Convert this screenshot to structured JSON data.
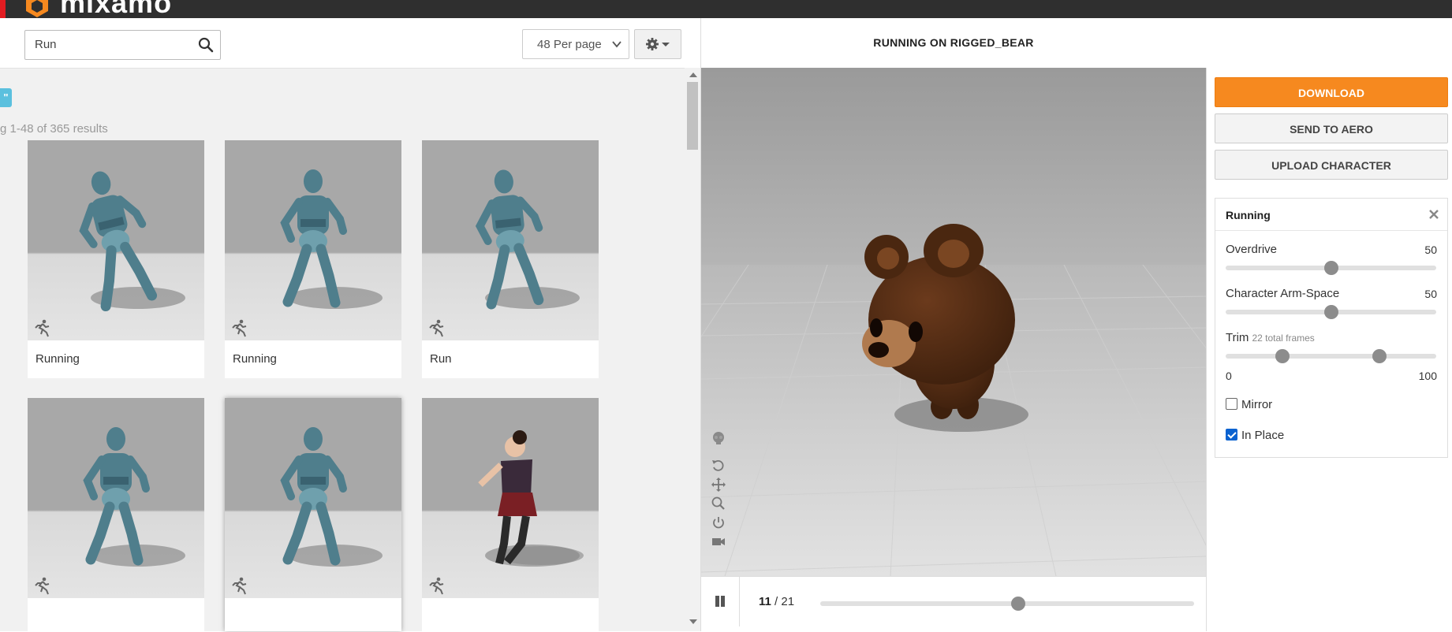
{
  "brand": {
    "logo_text": "mixamo",
    "accent": "#e21c21"
  },
  "search": {
    "value": "Run",
    "icon": "search-icon"
  },
  "toolbar": {
    "per_page": "48 Per page",
    "settings_icon": "gear-icon"
  },
  "filter_tag": "\"",
  "results_text": "g 1-48 of 365 results",
  "cards": [
    {
      "title": "Running",
      "kind": "robot-run-back"
    },
    {
      "title": "Running",
      "kind": "robot-run-side"
    },
    {
      "title": "Run",
      "kind": "robot-run-stride"
    },
    {
      "title": "",
      "kind": "robot-front"
    },
    {
      "title": "",
      "kind": "robot-front"
    },
    {
      "title": "",
      "kind": "girl-run"
    }
  ],
  "viewer": {
    "title": "RUNNING ON RIGGED_BEAR",
    "frame_current": "11",
    "frame_total": "/ 21",
    "progress": 0.53
  },
  "side": {
    "download_label": "DOWNLOAD",
    "aero_label": "SEND TO AERO",
    "upload_label": "UPLOAD CHARACTER",
    "download_color": "#f6891f"
  },
  "panel": {
    "title": "Running",
    "overdrive_label": "Overdrive",
    "overdrive_value": "50",
    "overdrive_pos": 0.5,
    "armspace_label": "Character Arm-Space",
    "armspace_value": "50",
    "armspace_pos": 0.5,
    "trim_label": "Trim",
    "trim_note": "22 total frames",
    "trim_start_pos": 0.27,
    "trim_end_pos": 0.73,
    "trim_min": "0",
    "trim_max": "100",
    "mirror_label": "Mirror",
    "mirror_checked": false,
    "inplace_label": "In Place",
    "inplace_checked": true
  }
}
